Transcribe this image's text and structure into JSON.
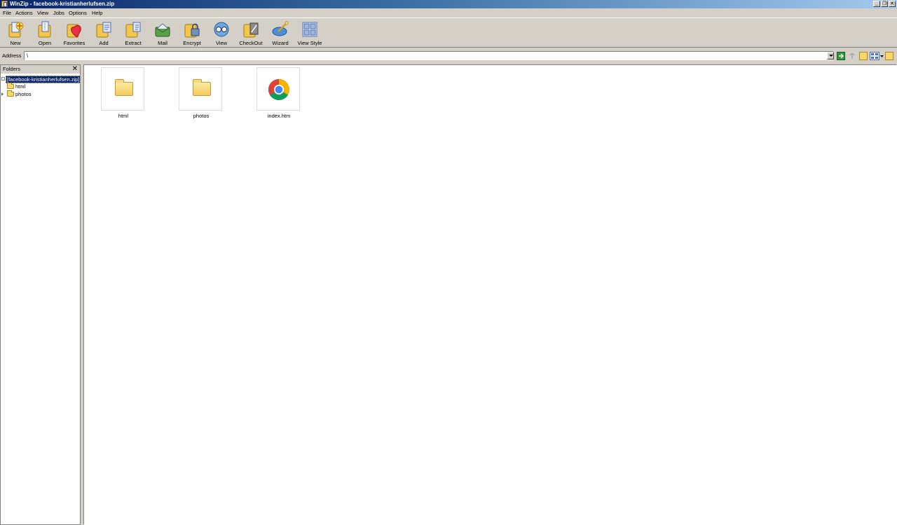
{
  "window": {
    "title": "WinZip - facebook-kristianherlufsen.zip",
    "minimize": "_",
    "restore": "❐",
    "close": "✕"
  },
  "menu": [
    "File",
    "Actions",
    "View",
    "Jobs",
    "Options",
    "Help"
  ],
  "toolbar": [
    {
      "label": "New",
      "icon": "new-icon"
    },
    {
      "label": "Open",
      "icon": "open-icon"
    },
    {
      "label": "Favorites",
      "icon": "favorites-icon"
    },
    {
      "label": "Add",
      "icon": "add-icon"
    },
    {
      "label": "Extract",
      "icon": "extract-icon"
    },
    {
      "label": "Mail",
      "icon": "mail-icon"
    },
    {
      "label": "Encrypt",
      "icon": "encrypt-icon"
    },
    {
      "label": "View",
      "icon": "view-icon"
    },
    {
      "label": "CheckOut",
      "icon": "checkout-icon"
    },
    {
      "label": "Wizard",
      "icon": "wizard-icon"
    },
    {
      "label": "View Style",
      "icon": "view-style-icon"
    }
  ],
  "address": {
    "label": "Address",
    "value": "\\"
  },
  "folders_pane": {
    "title": "Folders",
    "close": "✕",
    "root": "[facebook-kristianherlufsen.zip]",
    "children": [
      "html",
      "photos"
    ]
  },
  "files": [
    {
      "name": "html",
      "type": "folder"
    },
    {
      "name": "photos",
      "type": "folder"
    },
    {
      "name": "index.htm",
      "type": "chrome-document"
    }
  ],
  "colors": {
    "titlebar_start": "#0a246a",
    "titlebar_end": "#a6caf0",
    "chrome_face": "#d4d0c8",
    "selection": "#0a246a"
  }
}
